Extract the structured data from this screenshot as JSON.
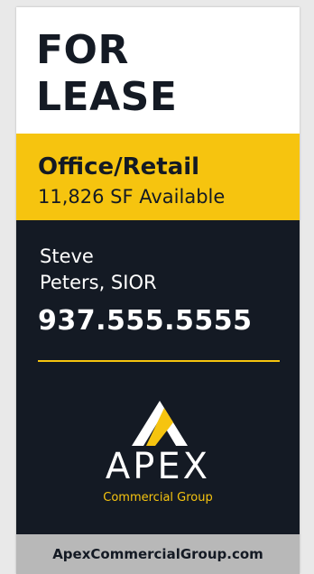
{
  "sign": {
    "headline_line1": "FOR",
    "headline_line2": "LEASE",
    "property_type": "Office/Retail",
    "available_space": "11,826 SF Available",
    "agent_line1": "Steve",
    "agent_line2": "Peters, SIOR",
    "phone": "937.555.5555",
    "brand_name": "APEX",
    "brand_subtitle": "Commercial Group",
    "website": "ApexCommercialGroup.com"
  },
  "colors": {
    "navy": "#141a24",
    "yellow": "#f6c40f",
    "white": "#ffffff",
    "footer_gray": "#b8b8b8"
  },
  "icons": {
    "logo": "apex-mountain-logo-icon"
  }
}
